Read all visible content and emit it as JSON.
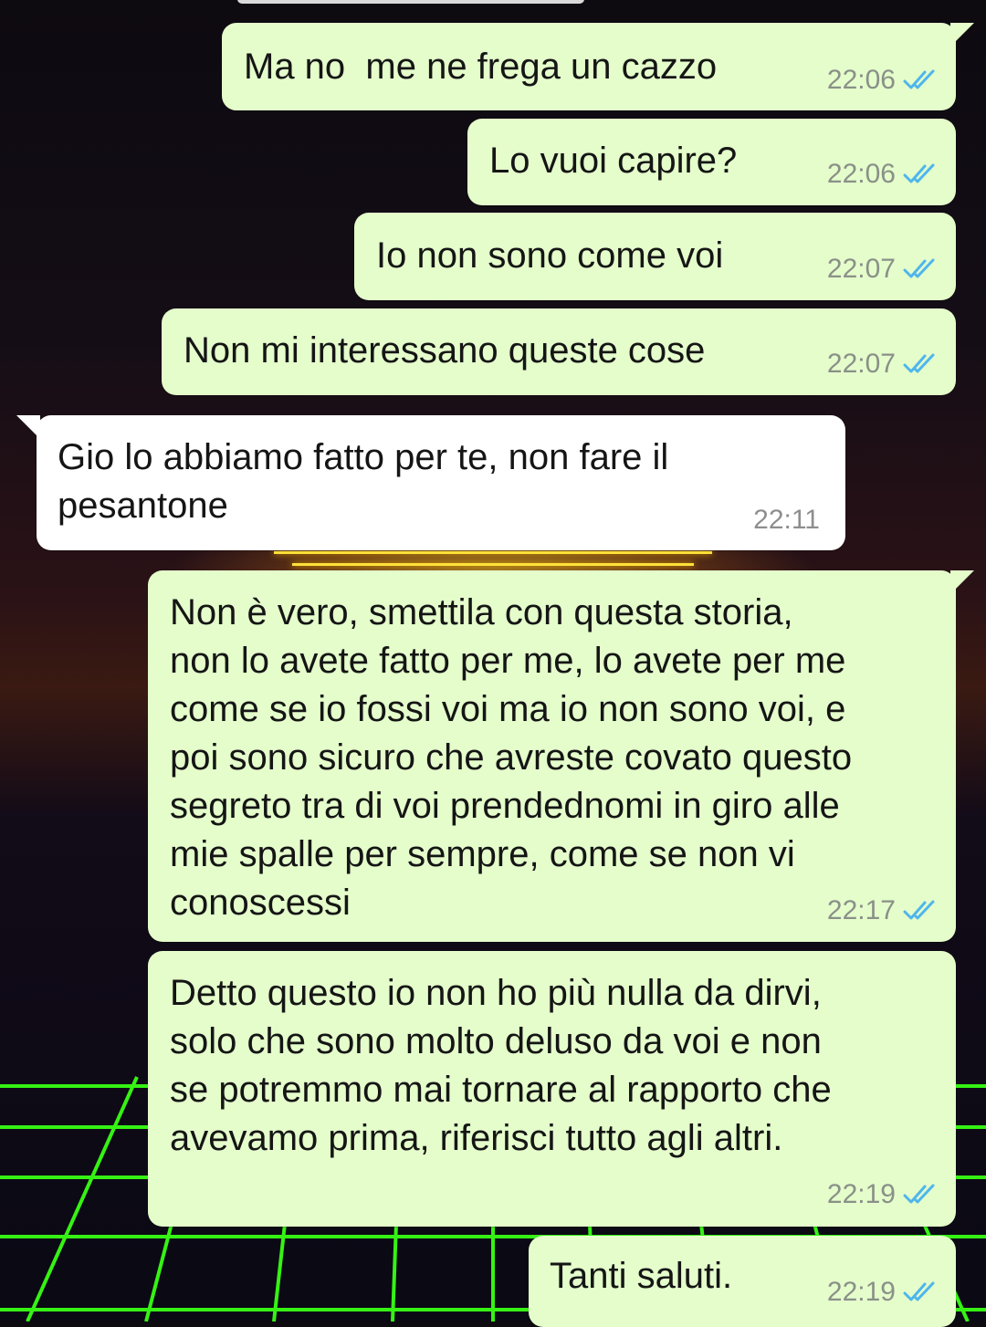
{
  "messages": [
    {
      "direction": "out",
      "text": "Ma no  me ne frega un cazzo",
      "time": "22:06",
      "status_icon": "double-check-read-icon"
    },
    {
      "direction": "out",
      "text": "Lo vuoi capire?",
      "time": "22:06",
      "status_icon": "double-check-read-icon"
    },
    {
      "direction": "out",
      "text": "Io non sono come voi",
      "time": "22:07",
      "status_icon": "double-check-read-icon"
    },
    {
      "direction": "out",
      "text": "Non mi interessano queste cose",
      "time": "22:07",
      "status_icon": "double-check-read-icon"
    },
    {
      "direction": "in",
      "text": "Gio lo abbiamo fatto per te, non fare il\npesantone",
      "time": "22:11"
    },
    {
      "direction": "out",
      "text": "Non è vero, smettila con questa storia,\nnon lo avete fatto per me, lo avete per me\ncome se io fossi voi ma io non sono voi, e\npoi sono sicuro che avreste covato questo\nsegreto tra di voi prendednomi in giro alle\nmie spalle per sempre, come se non vi\nconoscessi",
      "time": "22:17",
      "status_icon": "double-check-read-icon"
    },
    {
      "direction": "out",
      "text": "Detto questo io non ho più nulla da dirvi,\nsolo che sono molto deluso da voi e non\nse potremmo mai tornare al rapporto che\navevamo prima, riferisci tutto agli altri.",
      "time": "22:19",
      "status_icon": "double-check-read-icon"
    },
    {
      "direction": "out",
      "text": "Tanti saluti.",
      "time": "22:19",
      "status_icon": "double-check-read-icon"
    }
  ],
  "colors": {
    "outgoing_bubble": "#e4fdcb",
    "incoming_bubble": "#ffffff",
    "read_ticks": "#4fb6ec",
    "timestamp": "#8a9088",
    "wallpaper_grid": "#39ff14",
    "wallpaper_sun": "#ffe23a"
  }
}
